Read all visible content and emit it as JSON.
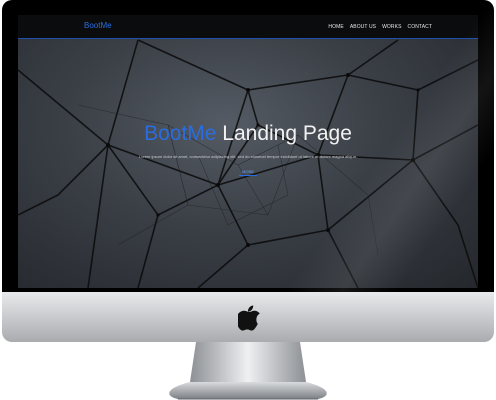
{
  "navbar": {
    "brand": "BootMe",
    "links": [
      "HOME",
      "ABOUT US",
      "WORKS",
      "CONTACT"
    ]
  },
  "hero": {
    "title_accent": "BootMe",
    "title_rest": "Landing Page",
    "subtitle": "Lorem ipsum dolor sit amet, consectetur adipiscing elit, sed do eiusmod tempor incididunt ut labore et dolore magna aliqua.",
    "button_label": "MORE"
  },
  "colors": {
    "accent": "#2a6de0",
    "navbar_bg": "#0b0c0e",
    "hero_bg": "#3a3f46",
    "bezel": "#000000",
    "chin": "#cfd1d4"
  },
  "icons": {
    "chin_logo": "apple-logo-icon"
  }
}
